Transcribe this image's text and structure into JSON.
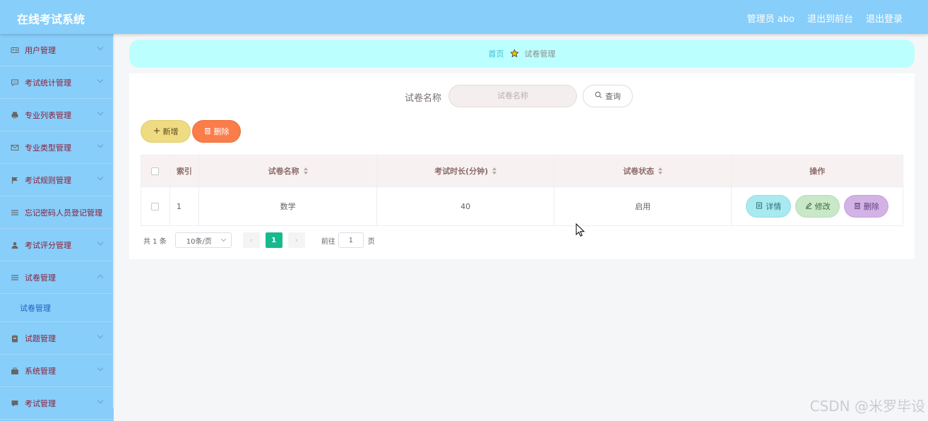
{
  "header": {
    "title": "在线考试系统",
    "links": [
      "管理员 abo",
      "退出到前台",
      "退出登录"
    ],
    "bg_color": "#87cefa"
  },
  "sidebar": {
    "items": [
      {
        "label": "用户管理",
        "icon": "id-card-icon"
      },
      {
        "label": "考试统计管理",
        "icon": "chat-icon"
      },
      {
        "label": "专业列表管理",
        "icon": "printer-icon"
      },
      {
        "label": "专业类型管理",
        "icon": "mail-icon"
      },
      {
        "label": "考试规则管理",
        "icon": "flag-icon"
      },
      {
        "label": "忘记密码人员登记管理",
        "icon": "list-icon"
      },
      {
        "label": "考试评分管理",
        "icon": "user-icon"
      },
      {
        "label": "试卷管理",
        "icon": "list-icon",
        "expanded": true
      },
      {
        "label": "试题管理",
        "icon": "clipboard-icon"
      },
      {
        "label": "系统管理",
        "icon": "briefcase-icon"
      },
      {
        "label": "考试管理",
        "icon": "message-icon"
      }
    ],
    "submenu": {
      "label": "试卷管理"
    }
  },
  "breadcrumb": {
    "home": "首页",
    "current": "试卷管理"
  },
  "search": {
    "label": "试卷名称",
    "placeholder": "试卷名称",
    "button": "查询"
  },
  "actions": {
    "add": "新增",
    "delete": "删除"
  },
  "table": {
    "headers": [
      "索引",
      "试卷名称",
      "考试时长(分钟)",
      "试卷状态",
      "操作"
    ],
    "rows": [
      {
        "index": "1",
        "name": "数学",
        "duration": "40",
        "status": "启用"
      }
    ],
    "row_actions": {
      "detail": "详情",
      "edit": "修改",
      "delete": "删除"
    }
  },
  "pagination": {
    "total": "共 1 条",
    "page_size": "10条/页",
    "current_page": "1",
    "goto_label": "前往",
    "goto_value": "1",
    "page_unit": "页"
  },
  "watermark": "CSDN @米罗毕设"
}
